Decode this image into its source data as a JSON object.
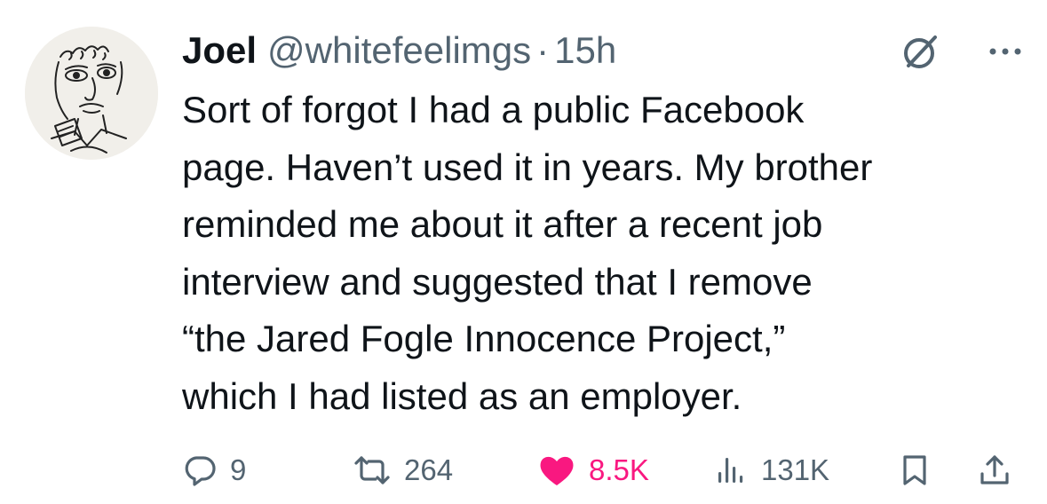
{
  "author": {
    "name": "Joel",
    "handle": "@whitefeelimgs",
    "separator": "·",
    "time": "15h",
    "avatar_icon": "sketch-portrait-avatar"
  },
  "tweet": {
    "text": "Sort of forgot I had a public Facebook\npage. Haven’t used it in years. My brother\nreminded me about it after a recent job\ninterview and suggested that I remove\n“the Jared Fogle Innocence Project,”\nwhich I had listed as an employer."
  },
  "actions": {
    "replies": "9",
    "retweets": "264",
    "likes": "8.5K",
    "views": "131K",
    "liked": true
  },
  "colors": {
    "text": "#0f1419",
    "secondary": "#536471",
    "like_pink": "#f91880"
  },
  "icons": [
    "grok-icon",
    "more-icon",
    "reply-icon",
    "retweet-icon",
    "heart-icon",
    "views-icon",
    "bookmark-icon",
    "share-icon"
  ]
}
